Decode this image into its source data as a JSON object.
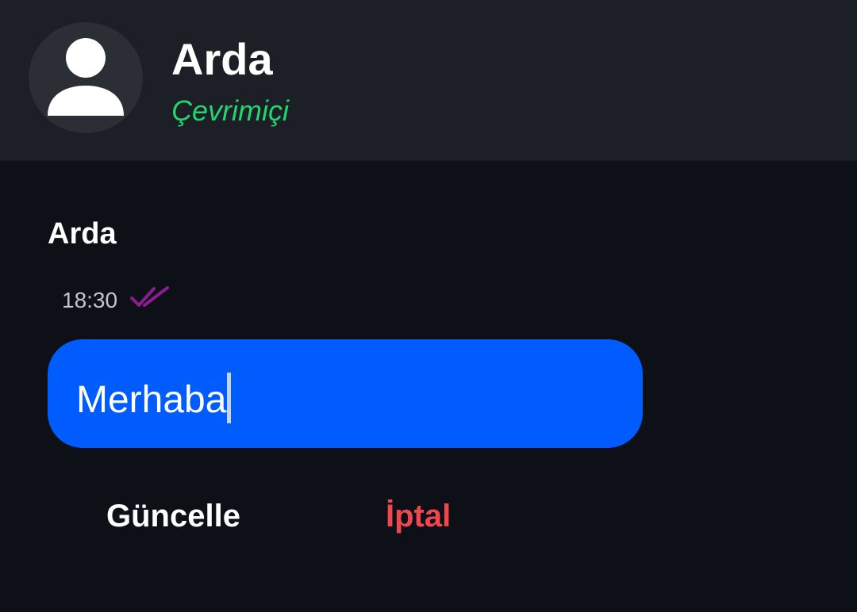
{
  "header": {
    "contact_name": "Arda",
    "status": "Çevrimiçi",
    "status_color": "#23d46f",
    "avatar_icon": "person-icon"
  },
  "message": {
    "sender": "Arda",
    "time": "18:30",
    "read_icon": "double-check-icon",
    "read_icon_color": "#8a1d8f"
  },
  "editor": {
    "value": "Merhaba",
    "background_color": "#005cff"
  },
  "actions": {
    "update_label": "Güncelle",
    "cancel_label": "İptal",
    "cancel_color": "#f0474f"
  }
}
